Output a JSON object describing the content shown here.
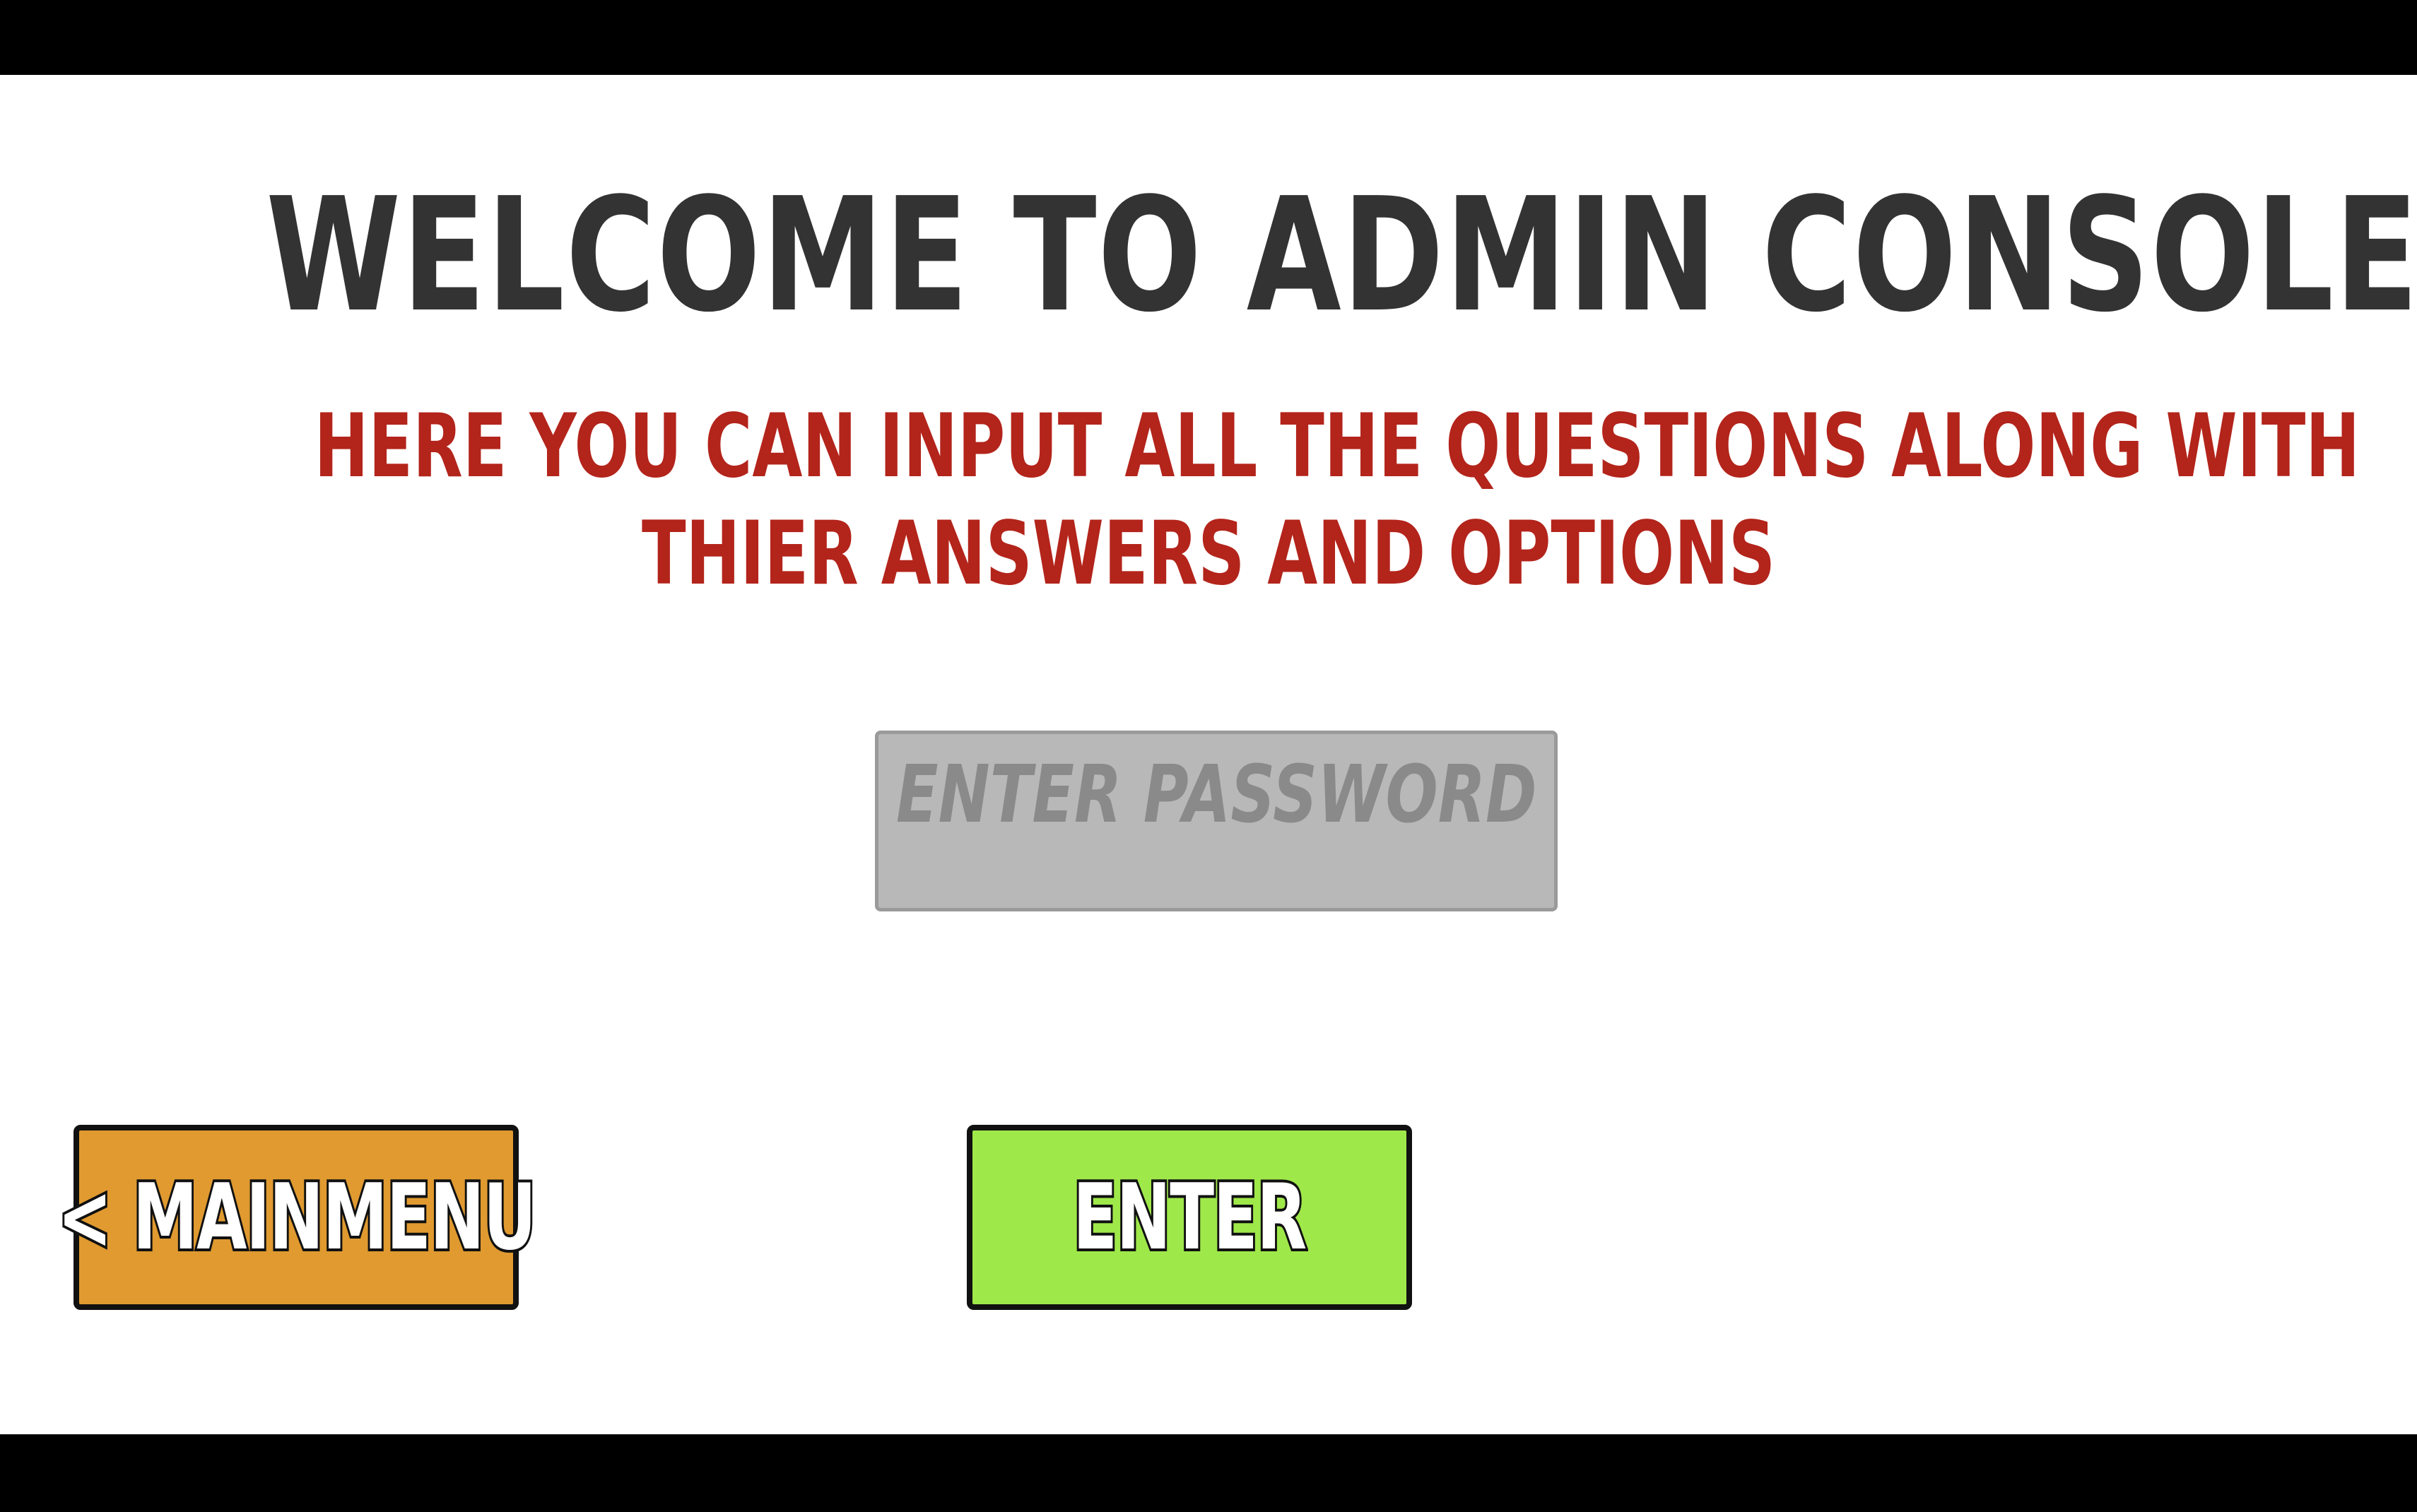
{
  "screen": {
    "title": "WELCOME TO ADMIN CONSOLE",
    "subtitle_line1": "HERE YOU CAN INPUT ALL THE QUESTIONS ALONG WITH",
    "subtitle_line2": "THIER ANSWERS AND OPTIONS"
  },
  "password": {
    "value": "",
    "placeholder": "ENTER PASSWORD"
  },
  "buttons": {
    "main_menu_label": "< MAINMENU",
    "enter_label": "ENTER"
  },
  "colors": {
    "title": "#333333",
    "subtitle": "#b3241b",
    "input_bg": "#b8b8b8",
    "main_menu_button": "#e09a30",
    "enter_button": "#9fe84a",
    "letterbox": "#000000"
  }
}
